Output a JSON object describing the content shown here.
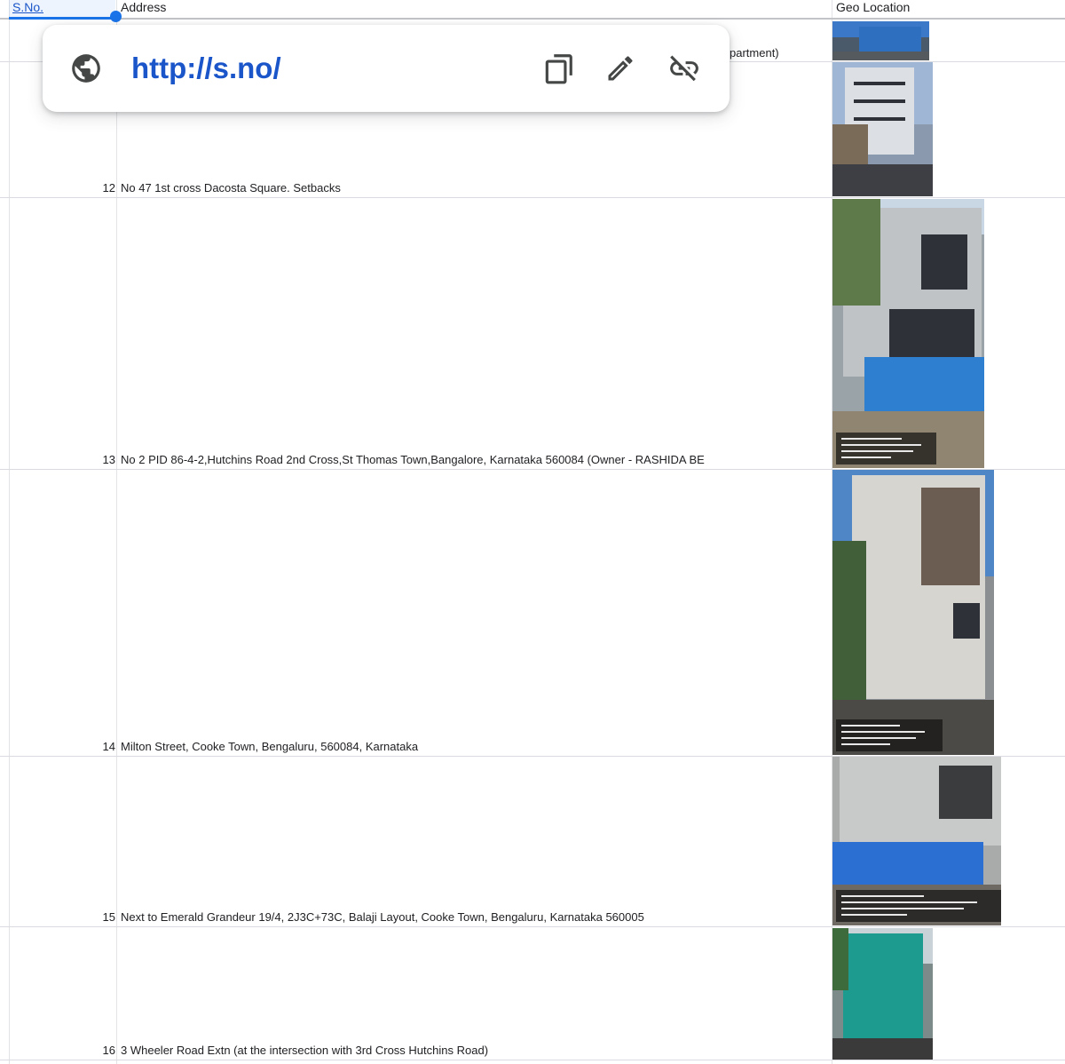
{
  "headers": {
    "sno": "S.No.",
    "address": "Address",
    "geo": "Geo Location"
  },
  "clipped_prev_address": "partment)",
  "rows": [
    {
      "num": "12",
      "address": "No 47 1st cross Dacosta Square. Setbacks"
    },
    {
      "num": "13",
      "address": "No 2 PID 86-4-2,Hutchins Road 2nd Cross,St Thomas Town,Bangalore, Karnataka 560084 (Owner - RASHIDA BE"
    },
    {
      "num": "14",
      "address": "Milton Street, Cooke Town, Bengaluru, 560084, Karnataka"
    },
    {
      "num": "15",
      "address": "Next to Emerald Grandeur 19/4,  2J3C+73C, Balaji Layout, Cooke Town, Bengaluru, Karnataka 560005"
    },
    {
      "num": "16",
      "address": "3 Wheeler Road Extn (at the intersection with 3rd Cross Hutchins Road)"
    }
  ],
  "link_popup": {
    "url": "http://s.no/",
    "icons": [
      "globe-icon",
      "copy-icon",
      "edit-icon",
      "unlink-icon"
    ]
  },
  "colors": {
    "link": "#1a55c9",
    "selection": "#1a73e8",
    "grid": "#d9dbe0"
  }
}
